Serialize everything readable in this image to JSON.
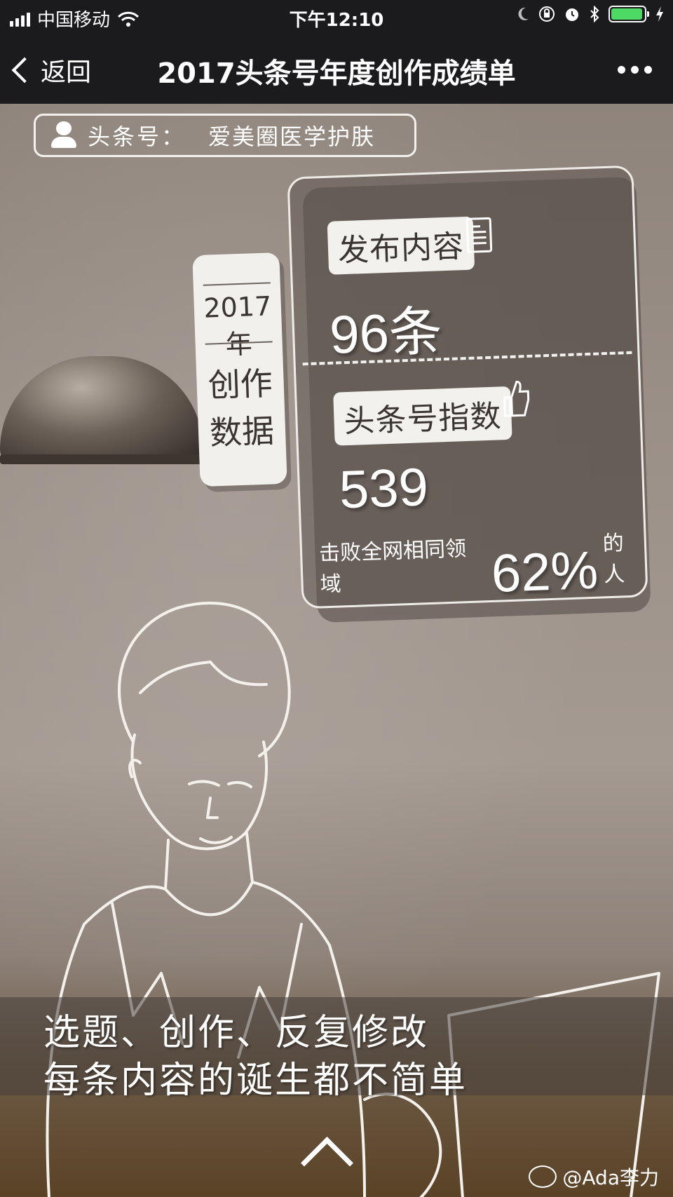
{
  "status_bar": {
    "carrier": "中国移动",
    "time": "下午12:10",
    "battery_level": 0.95,
    "colors": {
      "battery": "#4cd964"
    },
    "icons": [
      "signal-icon",
      "wifi-icon",
      "moon-icon",
      "orientation-lock-icon",
      "alarm-icon",
      "bluetooth-icon",
      "battery-icon",
      "charging-icon"
    ]
  },
  "nav": {
    "back_label": "返回",
    "title": "2017头条号年度创作成绩单",
    "more_icon": "more-icon"
  },
  "account": {
    "label": "头条号：",
    "name": "爱美圈医学护肤"
  },
  "year_card": {
    "year": "2017年",
    "line1": "创作",
    "line2": "数据"
  },
  "stats": {
    "publish_label": "发布内容",
    "publish_value": "96条",
    "index_label": "头条号指数",
    "index_value": "539",
    "beat_prefix": "击败全网相同领域",
    "beat_percent": "62%",
    "beat_suffix": "的人"
  },
  "caption": {
    "line1": "选题、创作、反复修改",
    "line2": "每条内容的诞生都不简单"
  },
  "watermark": "@Ada李力"
}
